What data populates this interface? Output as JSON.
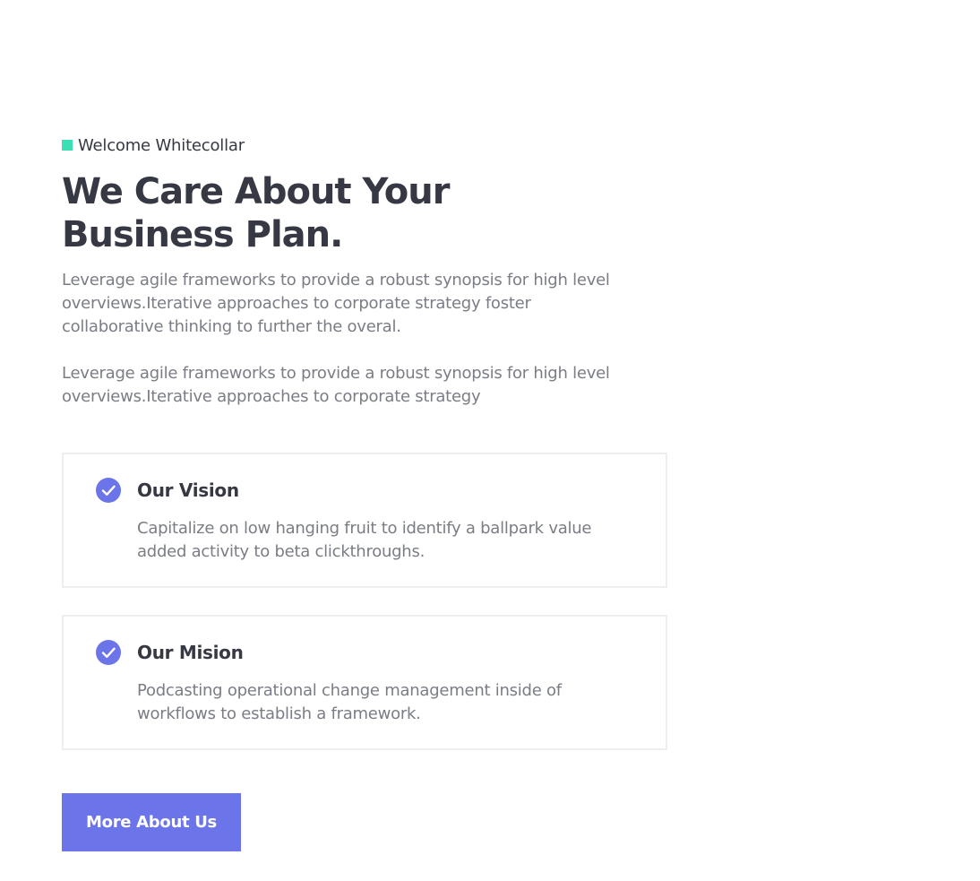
{
  "section": {
    "eyebrow": "Welcome Whitecollar",
    "heading": "We Care About Your Business Plan.",
    "paragraphs": [
      "Leverage agile frameworks to provide a robust synopsis for high level overviews.Iterative approaches to corporate strategy foster collaborative thinking to further the overal.",
      "Leverage agile frameworks to provide a robust synopsis for high level overviews.Iterative approaches to corporate strategy"
    ],
    "cards": [
      {
        "icon": "check-circle-icon",
        "title": "Our Vision",
        "description": "Capitalize on low hanging fruit to identify a ballpark value added activity to beta clickthroughs."
      },
      {
        "icon": "check-circle-icon",
        "title": "Our Mision",
        "description": "Podcasting operational change management inside of workflows to establish a framework."
      }
    ],
    "button_label": "More About Us"
  },
  "colors": {
    "accent": "#6c74e9",
    "eyebrow_marker": "#3cdfb4",
    "heading": "#363843",
    "body_text": "#7b7d86",
    "card_border": "#eeeeee"
  }
}
